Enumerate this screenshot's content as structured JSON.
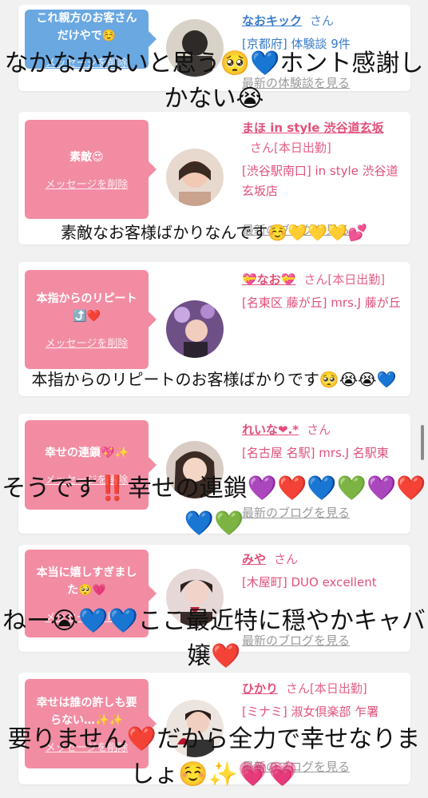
{
  "colors": {
    "page_background": "#f1f1f1",
    "blue_bubble": "#6aa8e2",
    "pink_bubble": "#f28ca3",
    "blue_text": "#3a7cc7",
    "pink_text": "#e1507a"
  },
  "cards": [
    {
      "message": "これ親方のお客さんだけやで☺️",
      "delete_label": "メッセージを削除",
      "name": "なおキック",
      "suffix": "さん",
      "meta": "[京都府] 体験談 9件",
      "blog": "最新の体験談を見る",
      "theme": "blue"
    },
    {
      "message": "素敵😍",
      "delete_label": "メッセージを削除",
      "name": "まほ in style 渋谷道玄坂",
      "suffix": "さん[本日出勤]",
      "meta": "[渋谷駅南口] in style 渋谷道玄坂店",
      "blog": "最新のブログを見る",
      "theme": "pink"
    },
    {
      "message": "本指からのリピート⤴️❤️",
      "delete_label": "メッセージを削除",
      "name": "💝なお💝",
      "suffix": "さん[本日出勤]",
      "meta": "[名東区 藤が丘] mrs.J 藤が丘",
      "blog": "",
      "theme": "pink"
    },
    {
      "message": "幸せの連鎖💖✨",
      "delete_label": "メッセージを削除",
      "name": "れいな❤︎.*",
      "suffix": "さん",
      "meta": "[名古屋 名駅] mrs.J 名駅東",
      "blog": "最新のブログを見る",
      "theme": "pink"
    },
    {
      "message": "本当に嬉しすぎました🥺💗",
      "delete_label": "メッセージを削除",
      "name": "みや",
      "suffix": "さん",
      "meta": "[木屋町] DUO excellent",
      "blog": "最新のブログを見る",
      "theme": "pink"
    },
    {
      "message": "幸せは誰の許しも要らない…✨✨",
      "delete_label": "メッセージを削除",
      "name": "ひかり",
      "suffix": "さん[本日出勤]",
      "meta": "[ミナミ] 淑女倶楽部 乍署",
      "blog": "最新のブログを見る",
      "theme": "pink"
    }
  ],
  "overlays": [
    "なかなかないと思う🥺💙ホント感謝しかない😭",
    "素敵なお客様ばかりなんです☺️💛💛💛💕",
    "本指からのリピートのお客様ばかりです🥺😭😭💙",
    "そうです‼️幸せの連鎖💜❤️💙💚💜❤️💙💚",
    "ねー😭💙💙ここ最近特に穏やかキャバ嬢❤️",
    "要りません❤️だから全力で幸せなりましょ☺️✨💗💗"
  ]
}
